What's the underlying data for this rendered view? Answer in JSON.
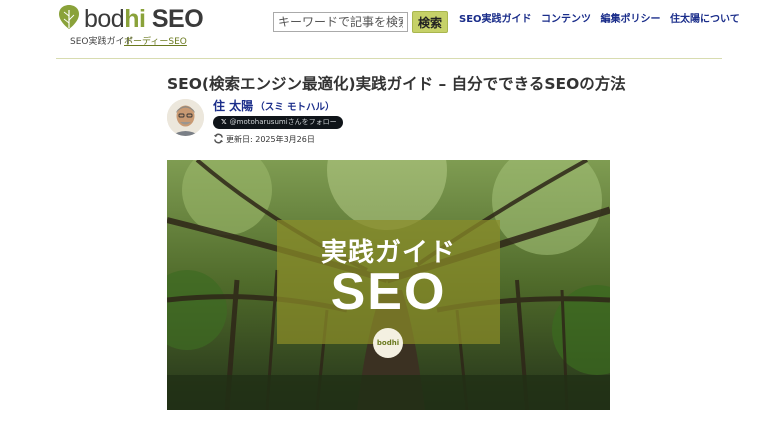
{
  "header": {
    "logo": {
      "word_bod": "bod",
      "word_hi": "hi",
      "word_seo": " SEO",
      "tagline_left": "SEO実践ガイド",
      "tagline_right": "ボーディーSEO"
    },
    "search": {
      "placeholder": "キーワードで記事を検索",
      "button_label": "検索"
    },
    "nav": [
      "SEO実践ガイド",
      "コンテンツ",
      "編集ポリシー",
      "住太陽について"
    ]
  },
  "article": {
    "title": "SEO(検索エンジン最適化)実践ガイド – 自分でできるSEOの方法",
    "author": {
      "name": "住 太陽",
      "kana": "（スミ モトハル）",
      "follow_label": "@motoharusumiさんをフォロー",
      "follow_icon": "x-logo-icon"
    },
    "updated": {
      "label": "更新日: 2025年3月26日",
      "icon": "refresh-icon"
    },
    "hero": {
      "subtitle": "実践ガイド",
      "main": "SEO",
      "badge": "bodhi"
    }
  },
  "colors": {
    "nav_link": "#1a2d8a",
    "accent_green": "#8aa23a",
    "search_button": "#c6d168",
    "divider": "#d8dcb0"
  }
}
